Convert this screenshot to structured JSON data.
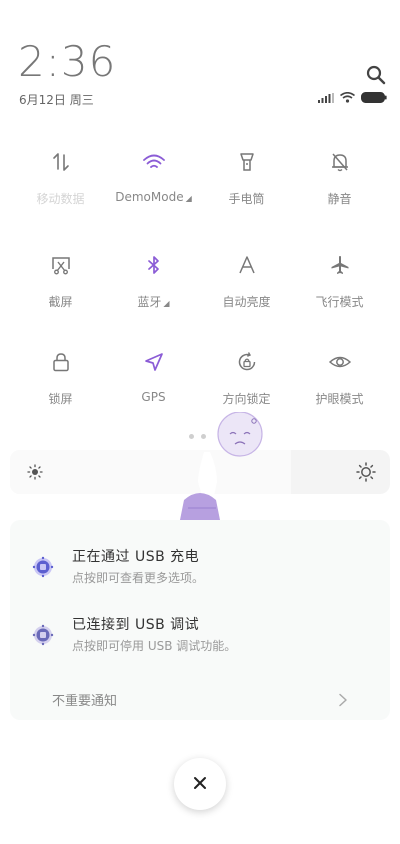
{
  "status": {
    "time": "2:36",
    "date": "6月12日 周三"
  },
  "tiles": [
    {
      "label": "移动数据",
      "icon": "data-arrows-icon",
      "dim": true,
      "active": false
    },
    {
      "label": "DemoMode",
      "icon": "wifi-icon",
      "dim": false,
      "active": true,
      "expandable": true
    },
    {
      "label": "手电筒",
      "icon": "flashlight-icon",
      "dim": false,
      "active": false
    },
    {
      "label": "静音",
      "icon": "bell-mute-icon",
      "dim": false,
      "active": false
    },
    {
      "label": "截屏",
      "icon": "screenshot-icon",
      "dim": false,
      "active": false
    },
    {
      "label": "蓝牙",
      "icon": "bluetooth-icon",
      "dim": false,
      "active": true,
      "expandable": true
    },
    {
      "label": "自动亮度",
      "icon": "auto-brightness-icon",
      "dim": false,
      "active": false
    },
    {
      "label": "飞行模式",
      "icon": "airplane-icon",
      "dim": false,
      "active": false
    },
    {
      "label": "锁屏",
      "icon": "lock-icon",
      "dim": false,
      "active": false
    },
    {
      "label": "GPS",
      "icon": "location-arrow-icon",
      "dim": false,
      "active": true
    },
    {
      "label": "方向锁定",
      "icon": "rotation-lock-icon",
      "dim": false,
      "active": false
    },
    {
      "label": "护眼模式",
      "icon": "eye-icon",
      "dim": false,
      "active": false
    }
  ],
  "brightness": {
    "level": 0.74
  },
  "notifications": [
    {
      "title": "正在通过 USB 充电",
      "subtitle": "点按即可查看更多选项。",
      "icon": "android-system-icon"
    },
    {
      "title": "已连接到 USB 调试",
      "subtitle": "点按即可停用 USB 调试功能。",
      "icon": "android-system-icon"
    }
  ],
  "unimportant_label": "不重要通知",
  "colors": {
    "accent": "#8b5cd6",
    "icon": "#777777"
  }
}
